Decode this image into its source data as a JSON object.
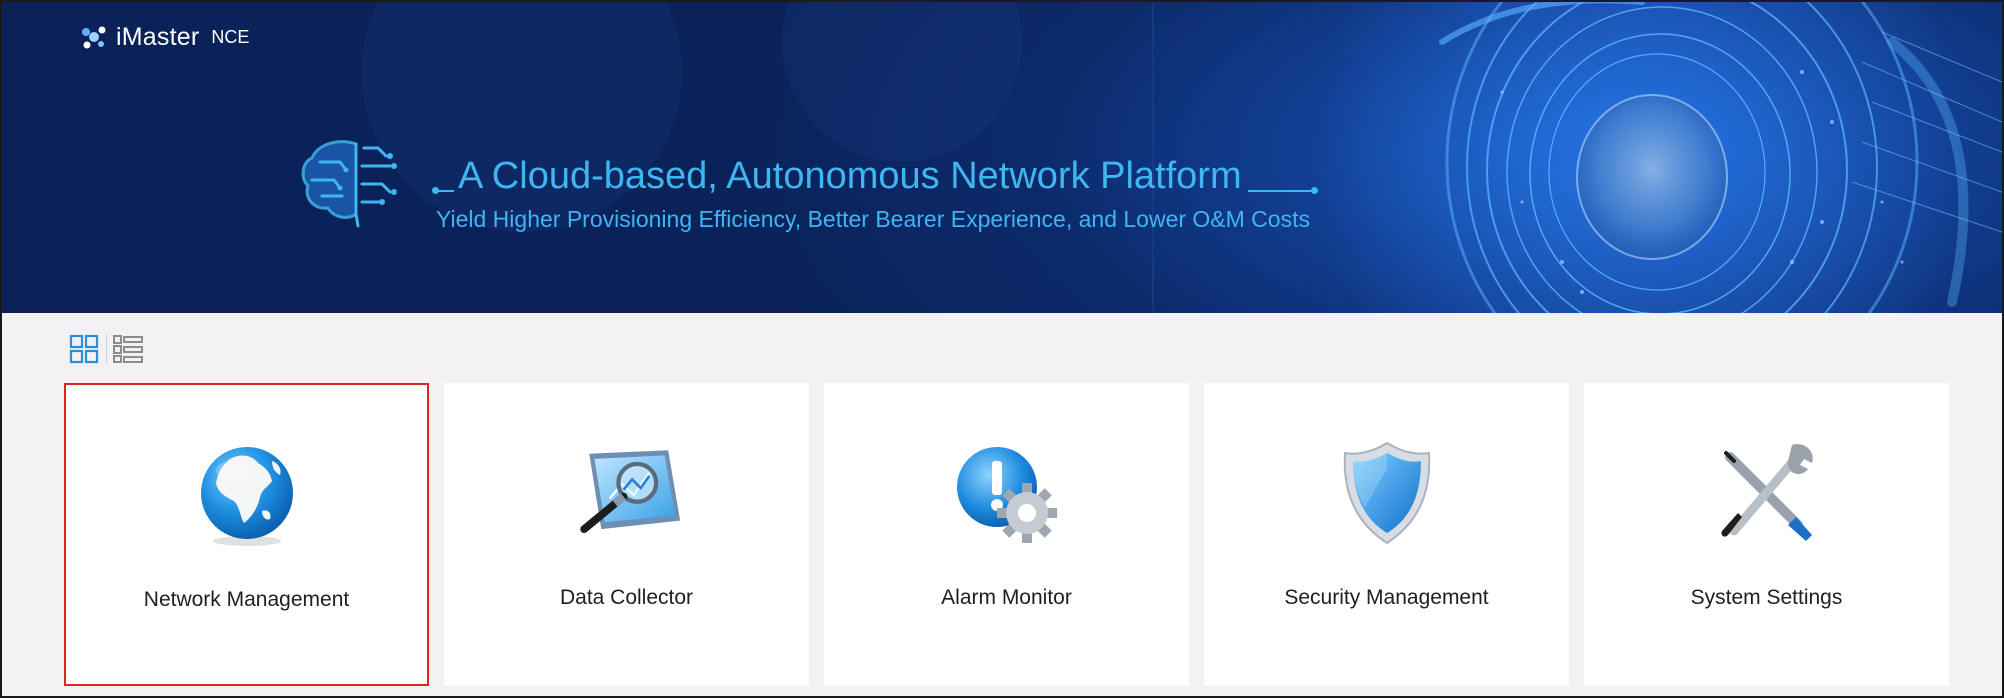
{
  "app": {
    "logo_name": "iMaster",
    "logo_suffix": "NCE"
  },
  "banner": {
    "title": "A Cloud-based, Autonomous Network Platform",
    "subtitle": "Yield Higher Provisioning Efficiency, Better Bearer Experience, and Lower O&M Costs"
  },
  "view_modes": [
    {
      "name": "grid-view",
      "active": true
    },
    {
      "name": "list-view",
      "active": false
    }
  ],
  "tiles": [
    {
      "label": "Network Management",
      "icon": "globe-icon",
      "selected": true
    },
    {
      "label": "Data Collector",
      "icon": "monitor-magnifier-icon",
      "selected": false
    },
    {
      "label": "Alarm Monitor",
      "icon": "alarm-gear-icon",
      "selected": false
    },
    {
      "label": "Security Management",
      "icon": "shield-icon",
      "selected": false
    },
    {
      "label": "System Settings",
      "icon": "tools-icon",
      "selected": false
    }
  ],
  "colors": {
    "accent": "#3fb6f2",
    "banner_dark": "#0a2258",
    "selection_border": "#e02424",
    "active_view_icon": "#2b8fd6"
  }
}
